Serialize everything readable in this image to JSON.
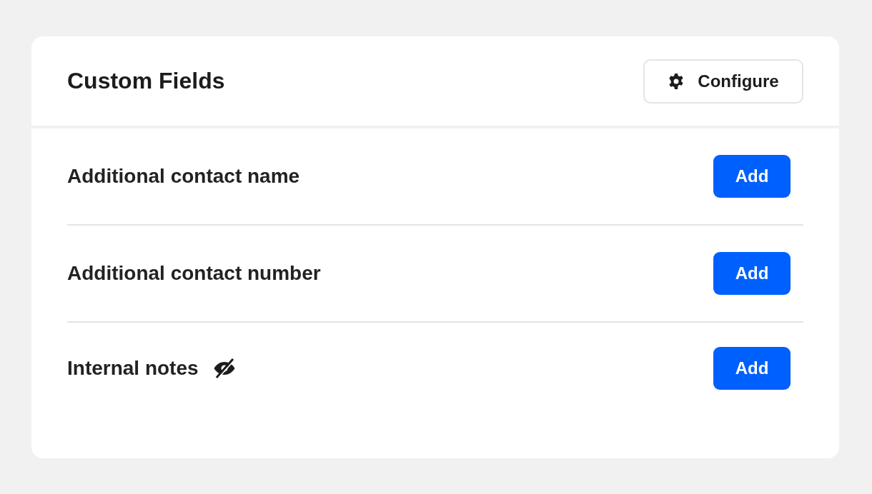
{
  "card": {
    "title": "Custom Fields",
    "configure_button": "Configure"
  },
  "fields": [
    {
      "label": "Additional contact name",
      "hidden": false,
      "button": "Add"
    },
    {
      "label": "Additional contact number",
      "hidden": false,
      "button": "Add"
    },
    {
      "label": "Internal notes",
      "hidden": true,
      "button": "Add"
    }
  ]
}
